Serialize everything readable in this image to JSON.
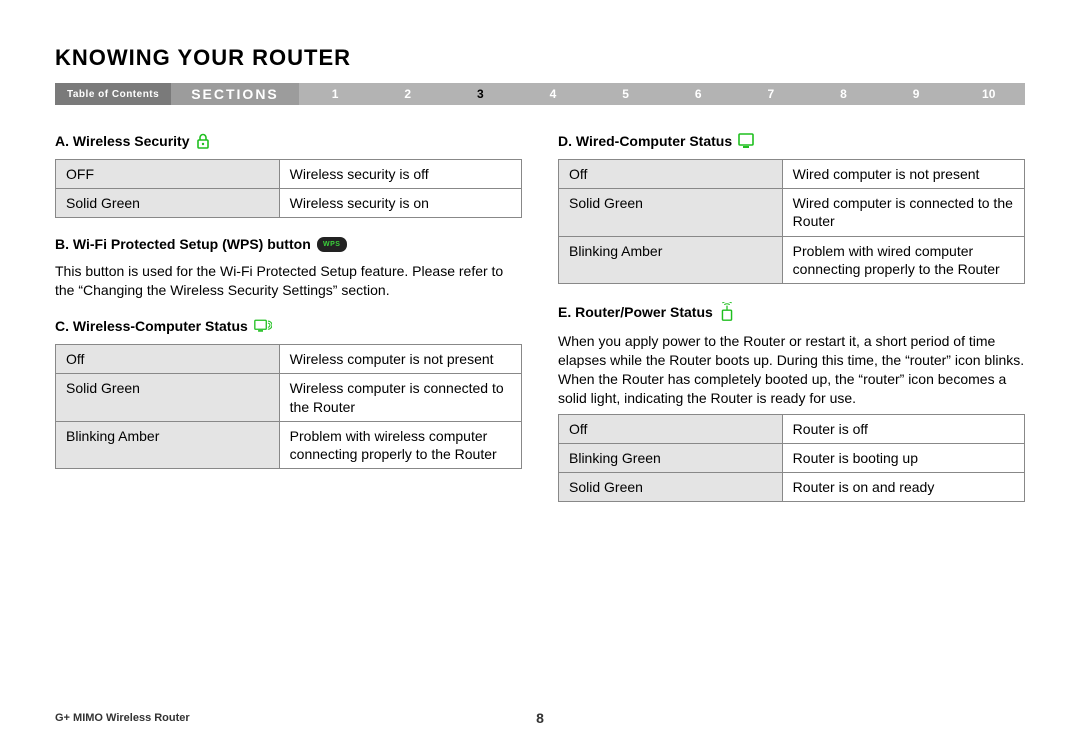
{
  "header": {
    "title": "KNOWING YOUR ROUTER"
  },
  "nav": {
    "toc": "Table of Contents",
    "sections_label": "SECTIONS",
    "numbers": [
      "1",
      "2",
      "3",
      "4",
      "5",
      "6",
      "7",
      "8",
      "9",
      "10"
    ],
    "active_index": 2
  },
  "left": {
    "a": {
      "heading": "A. Wireless Security",
      "rows": [
        {
          "state": "OFF",
          "desc": "Wireless security is off"
        },
        {
          "state": "Solid Green",
          "desc": "Wireless security is on"
        }
      ]
    },
    "b": {
      "heading": "B. Wi-Fi Protected Setup (WPS) button",
      "text": "This button is used for the Wi-Fi Protected Setup feature. Please refer to the “Changing the Wireless Security Settings” section."
    },
    "c": {
      "heading": "C. Wireless-Computer Status",
      "rows": [
        {
          "state": "Off",
          "desc": "Wireless computer is not present"
        },
        {
          "state": "Solid Green",
          "desc": "Wireless computer is connected to the Router"
        },
        {
          "state": "Blinking Amber",
          "desc": "Problem with wireless computer connecting properly to the Router"
        }
      ]
    }
  },
  "right": {
    "d": {
      "heading": "D. Wired-Computer Status",
      "rows": [
        {
          "state": "Off",
          "desc": "Wired computer is not present"
        },
        {
          "state": "Solid Green",
          "desc": "Wired computer is connected to the Router"
        },
        {
          "state": "Blinking Amber",
          "desc": "Problem with wired computer connecting properly to the Router"
        }
      ]
    },
    "e": {
      "heading": "E. Router/Power Status",
      "text": "When you apply power to the Router or restart it, a short period of time elapses while the Router boots up. During this time, the “router” icon blinks. When the Router has completely booted up, the “router” icon becomes a solid light, indicating the Router is ready for use.",
      "rows": [
        {
          "state": "Off",
          "desc": "Router is off"
        },
        {
          "state": "Blinking Green",
          "desc": "Router is booting up"
        },
        {
          "state": "Solid Green",
          "desc": "Router is on and ready"
        }
      ]
    }
  },
  "footer": {
    "product": "G+ MIMO Wireless Router",
    "page": "8"
  }
}
